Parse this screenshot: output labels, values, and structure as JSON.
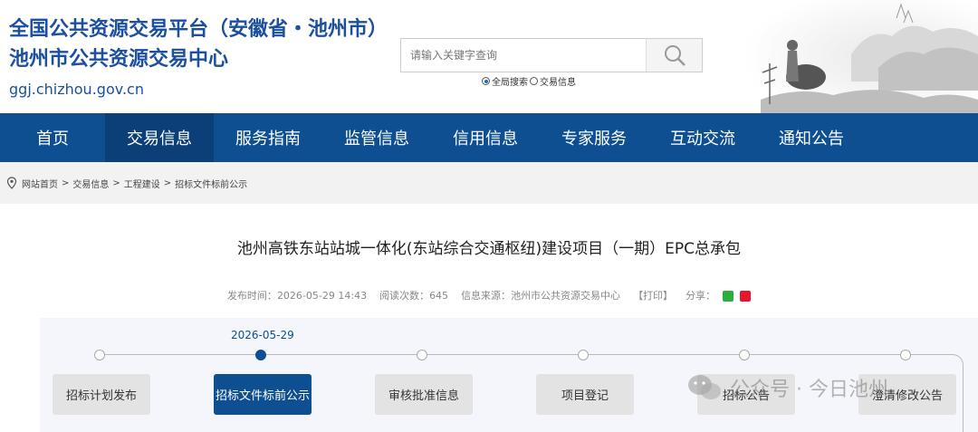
{
  "header": {
    "title": "全国公共资源交易平台（安徽省・池州市）",
    "subtitle": "池州市公共资源交易中心",
    "url": "ggj.chizhou.gov.cn"
  },
  "search": {
    "placeholder": "请输入关键字查询",
    "options": [
      "全局搜索",
      "交易信息"
    ],
    "selected": "全局搜索"
  },
  "nav": {
    "items": [
      "首页",
      "交易信息",
      "服务指南",
      "监管信息",
      "信用信息",
      "专家服务",
      "互动交流",
      "通知公告"
    ],
    "active": "交易信息"
  },
  "breadcrumb": [
    "网站首页",
    "交易信息",
    "工程建设",
    "招标文件标前公示"
  ],
  "article": {
    "title": "池州高铁东站站城一体化(东站综合交通枢纽)建设项目（一期）EPC总承包",
    "publish_label": "发布时间：",
    "publish_time": "2026-05-29 14:43",
    "views_label": "阅读次数：",
    "views": "645",
    "source_label": "信息来源：",
    "source": "池州市公共资源交易中心",
    "print": "【打印】",
    "share_label": "分享："
  },
  "timeline": {
    "date": "2026-05-29",
    "steps": [
      "招标计划发布",
      "招标文件标前公示",
      "审核批准信息",
      "项目登记",
      "招标公告",
      "澄清修改公告"
    ],
    "active_index": 1
  },
  "watermark": "公众号 · 今日池州",
  "colors": {
    "brand": "#0e4f92",
    "title": "#1b4fa0"
  }
}
